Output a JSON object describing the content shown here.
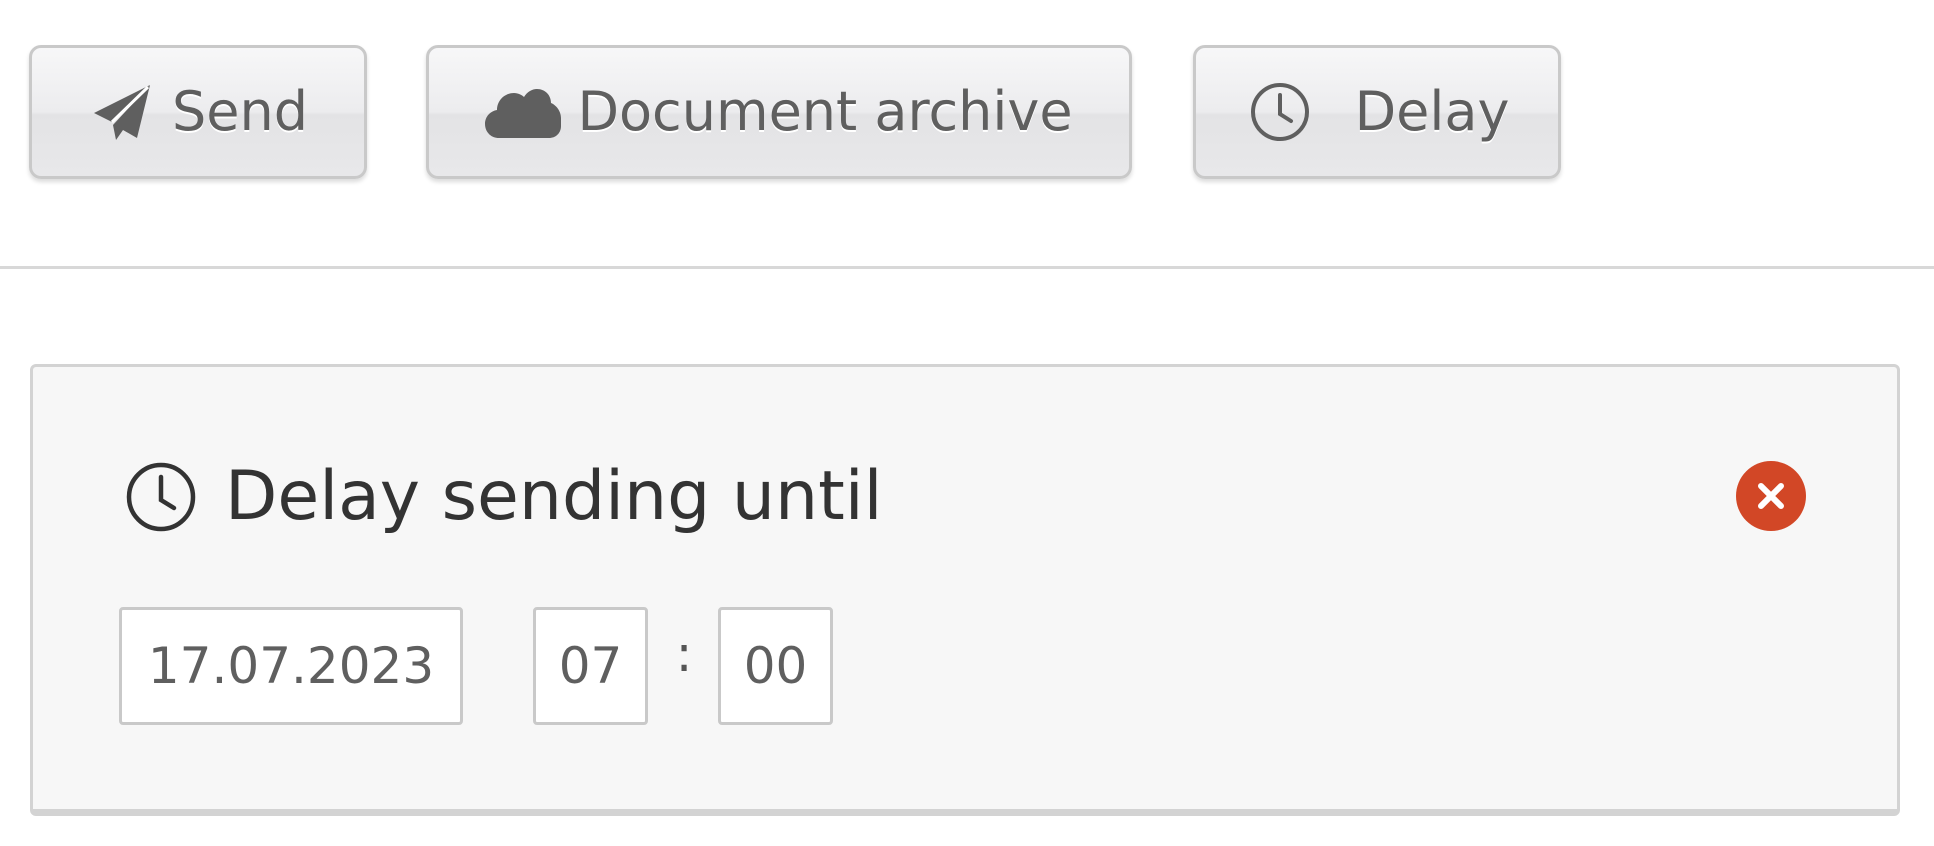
{
  "toolbar": {
    "send": {
      "label": "Send",
      "icon": "paper-plane-icon"
    },
    "archive": {
      "label": "Document archive",
      "icon": "cloud-icon"
    },
    "delay": {
      "label": "Delay",
      "icon": "clock-icon"
    }
  },
  "delay_panel": {
    "title": "Delay sending until",
    "title_icon": "clock-icon",
    "close_icon": "close-icon",
    "date": "17.07.2023",
    "hour": "07",
    "separator": ":",
    "minute": "00"
  },
  "colors": {
    "close_button": "#d24726",
    "panel_background": "#f7f7f7",
    "button_text": "#5f5f5f",
    "title_text": "#333333"
  }
}
